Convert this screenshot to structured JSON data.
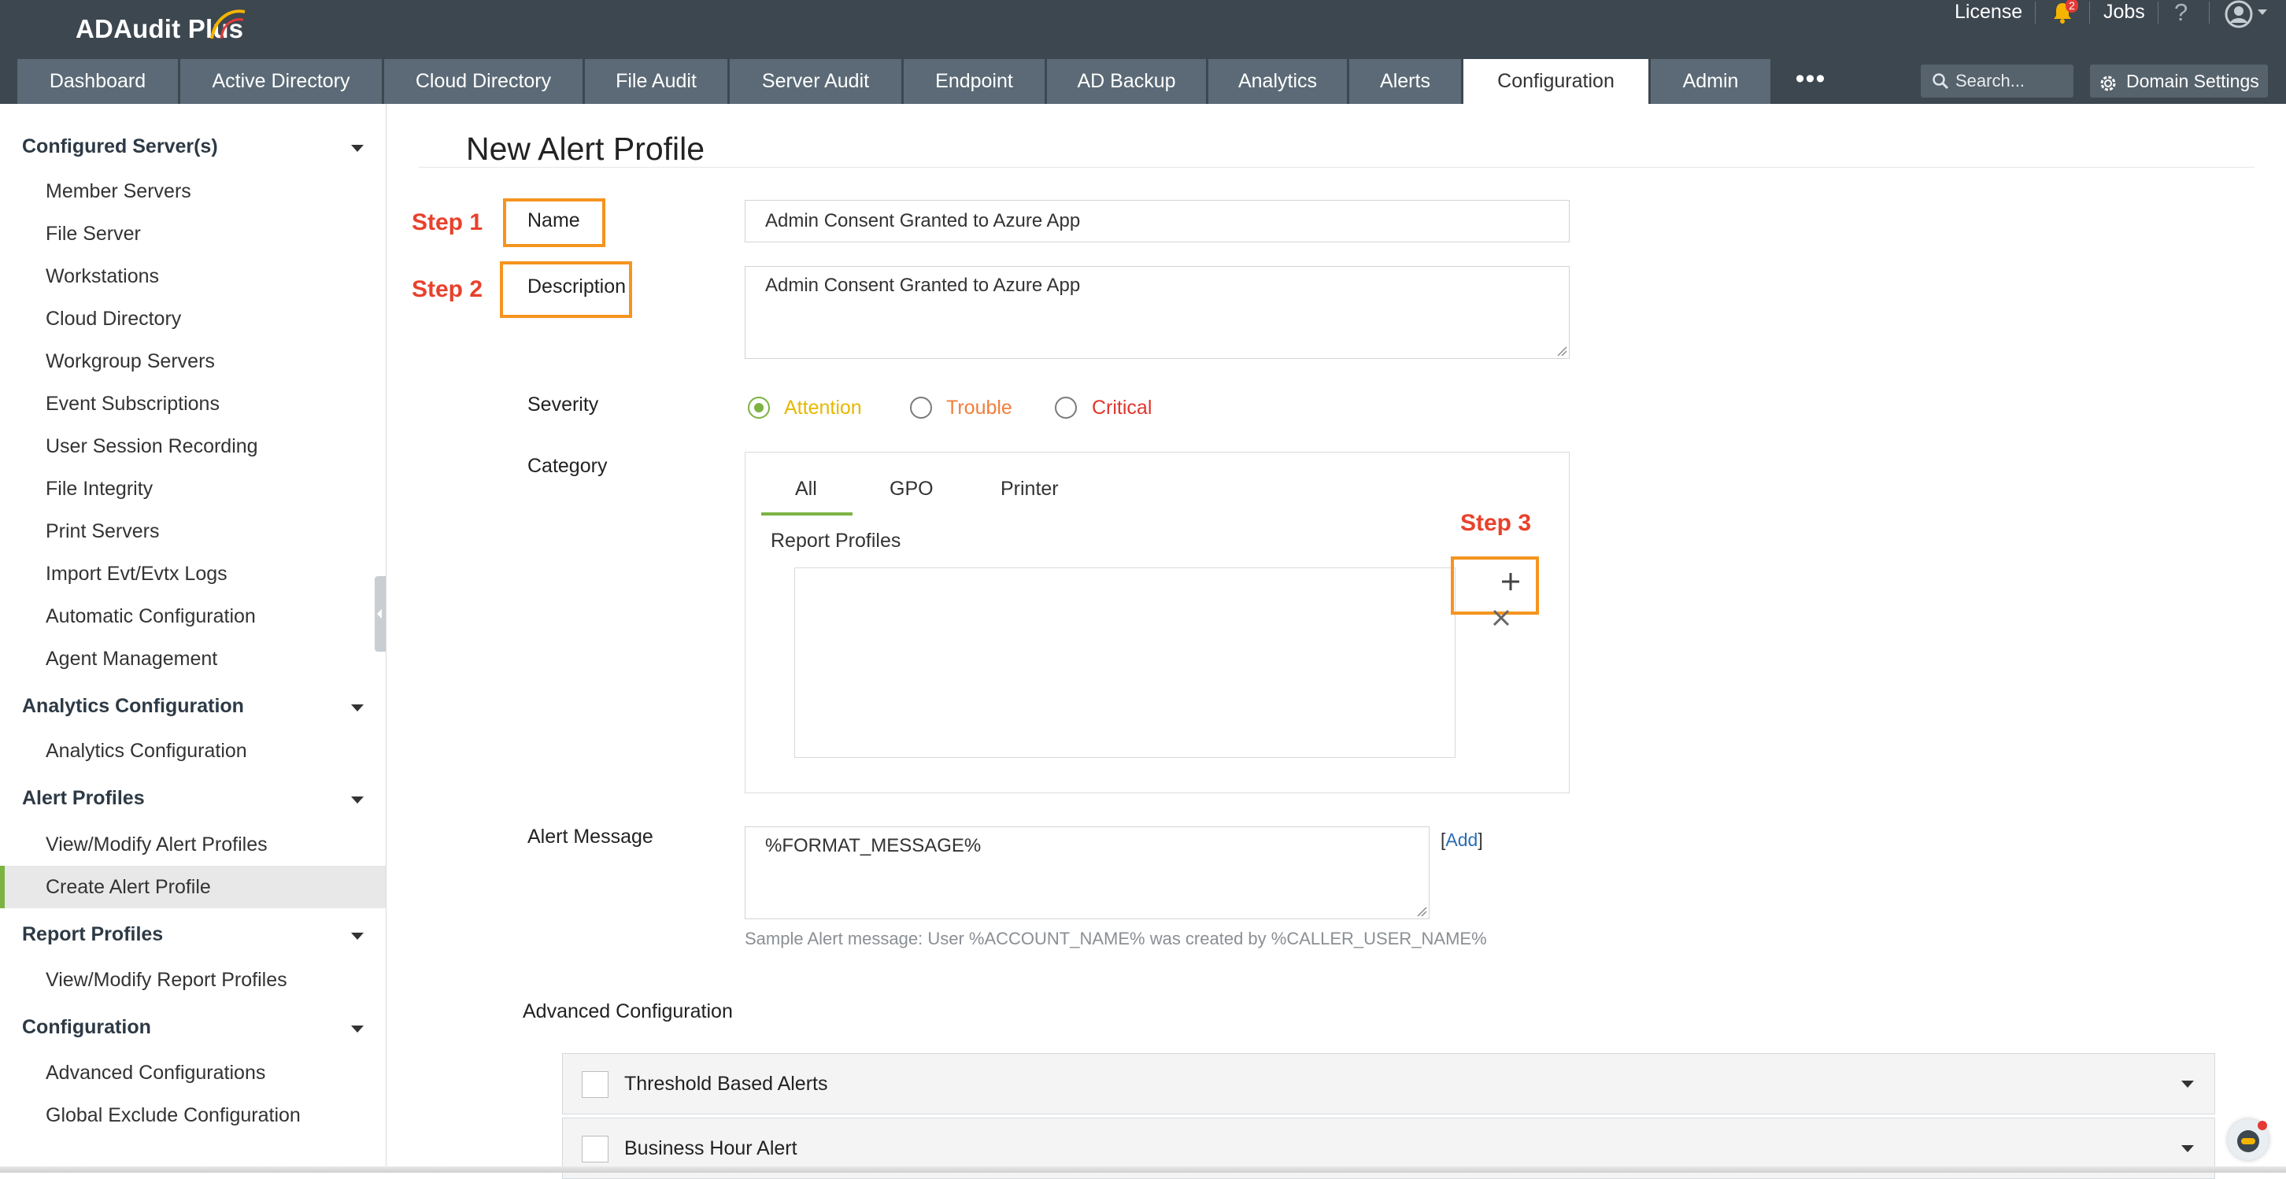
{
  "app": {
    "title": "ADAudit Plus"
  },
  "topbar": {
    "license": "License",
    "jobs": "Jobs",
    "help": "?",
    "notification_count": "2"
  },
  "nav": {
    "tabs": [
      {
        "label": "Dashboard"
      },
      {
        "label": "Active Directory"
      },
      {
        "label": "Cloud Directory"
      },
      {
        "label": "File Audit"
      },
      {
        "label": "Server Audit"
      },
      {
        "label": "Endpoint"
      },
      {
        "label": "AD Backup"
      },
      {
        "label": "Analytics"
      },
      {
        "label": "Alerts"
      },
      {
        "label": "Configuration"
      },
      {
        "label": "Admin"
      }
    ],
    "active_tab": "Configuration",
    "more": "•••",
    "search_placeholder": "Search...",
    "domain_settings": "Domain Settings"
  },
  "sidebar": {
    "sections": [
      {
        "title": "Configured Server(s)",
        "items": [
          "Member Servers",
          "File Server",
          "Workstations",
          "Cloud Directory",
          "Workgroup Servers",
          "Event Subscriptions",
          "User Session Recording",
          "File Integrity",
          "Print Servers",
          "Import Evt/Evtx Logs",
          "Automatic Configuration",
          "Agent Management"
        ]
      },
      {
        "title": "Analytics Configuration",
        "items": [
          "Analytics Configuration"
        ]
      },
      {
        "title": "Alert Profiles",
        "items": [
          "View/Modify Alert Profiles",
          "Create Alert Profile"
        ]
      },
      {
        "title": "Report Profiles",
        "items": [
          "View/Modify Report Profiles"
        ]
      },
      {
        "title": "Configuration",
        "items": [
          "Advanced Configurations",
          "Global Exclude Configuration"
        ]
      }
    ],
    "active_item": "Create Alert Profile"
  },
  "main": {
    "title": "New Alert Profile",
    "steps": [
      "Step 1",
      "Step 2",
      "Step 3"
    ],
    "name_label": "Name",
    "name_value": "Admin Consent Granted to Azure App",
    "description_label": "Description",
    "description_value": "Admin Consent Granted to Azure App",
    "severity_label": "Severity",
    "severity_options": [
      {
        "label": "Attention",
        "color": "#e6b800",
        "selected": true
      },
      {
        "label": "Trouble",
        "color": "#f07f3c",
        "selected": false
      },
      {
        "label": "Critical",
        "color": "#e0352b",
        "selected": false
      }
    ],
    "category_label": "Category",
    "category_tabs": [
      "All",
      "GPO",
      "Printer"
    ],
    "category_active": "All",
    "report_profiles_label": "Report Profiles",
    "alert_message_label": "Alert Message",
    "alert_message_value": "%FORMAT_MESSAGE%",
    "add_link": "Add",
    "sample_message": "Sample Alert message: User %ACCOUNT_NAME% was created by %CALLER_USER_NAME%",
    "advanced_title": "Advanced Configuration",
    "advanced_items": [
      {
        "label": "Threshold Based Alerts",
        "checked": false
      },
      {
        "label": "Business Hour Alert",
        "checked": false
      }
    ]
  },
  "colors": {
    "topbar": "#3d4750",
    "tab": "#5b6a76",
    "accent_green": "#7cb342",
    "step_red": "#e8412c",
    "highlight_orange": "#f5941f"
  }
}
